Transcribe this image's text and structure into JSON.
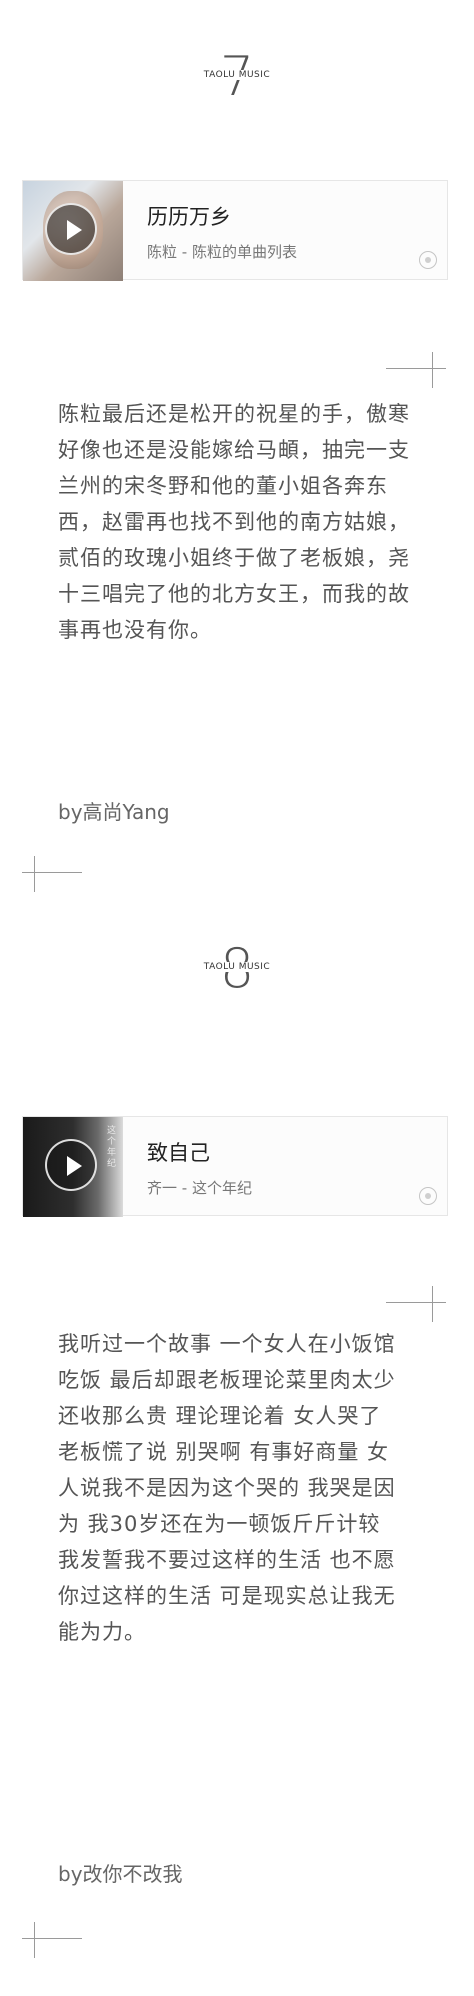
{
  "sections": [
    {
      "number": "7",
      "brand": "TAOLU MUSIC",
      "song": {
        "title": "历历万乡",
        "subtitle": "陈粒 - 陈粒的单曲列表"
      },
      "body": "陈粒最后还是松开的祝星的手，傲寒好像也还是没能嫁给马頔，抽完一支兰州的宋冬野和他的董小姐各奔东西，赵雷再也找不到他的南方姑娘，贰佰的玫瑰小姐终于做了老板娘，尧十三唱完了他的北方女王，而我的故事再也没有你。",
      "signature": "by高尚Yang"
    },
    {
      "number": "8",
      "brand": "TAOLU MUSIC",
      "song": {
        "title": "致自己",
        "subtitle": "齐一 - 这个年纪",
        "cover_text": "这个年纪"
      },
      "body": "我听过一个故事 一个女人在小饭馆吃饭 最后却跟老板理论菜里肉太少 还收那么贵 理论理论着 女人哭了 老板慌了说 别哭啊 有事好商量 女人说我不是因为这个哭的 我哭是因为 我30岁还在为一顿饭斤斤计较 我发誓我不要过这样的生活 也不愿你过这样的生活 可是现实总让我无能为力。",
      "signature": "by改你不改我"
    }
  ],
  "icons": {
    "play": "play-icon",
    "music": "music-note-icon"
  },
  "colors": {
    "text": "#555555",
    "title": "#222222",
    "border": "#e6e6e6",
    "line": "#9a9a9a"
  }
}
